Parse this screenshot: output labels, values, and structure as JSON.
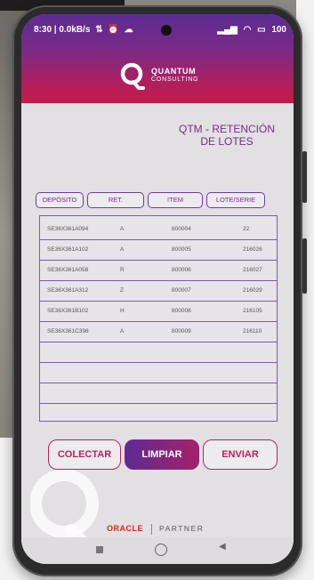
{
  "status_bar": {
    "left_text": "8:30 | 0.0kB/s",
    "right_text": "100"
  },
  "brand": {
    "line1": "QUANTUM",
    "line2": "CONSULTING"
  },
  "page": {
    "title_line1": "QTM - RETENCIÓN",
    "title_line2": "DE LOTES"
  },
  "columns": [
    "DEPÓSITO",
    "RET.",
    "ITEM",
    "LOTE/SERIE"
  ],
  "rows": [
    {
      "deposito": "SE36X361A094",
      "ret": "A",
      "item": "800004",
      "lote": "22"
    },
    {
      "deposito": "SE36X361A102",
      "ret": "A",
      "item": "800005",
      "lote": "216026"
    },
    {
      "deposito": "SE36X361A058",
      "ret": "R",
      "item": "800006",
      "lote": "216027"
    },
    {
      "deposito": "SE36X361A312",
      "ret": "Z",
      "item": "800007",
      "lote": "216029"
    },
    {
      "deposito": "SE36X361B102",
      "ret": "H",
      "item": "800008",
      "lote": "216105"
    },
    {
      "deposito": "SE36X361C398",
      "ret": "A",
      "item": "800009",
      "lote": "216110"
    }
  ],
  "buttons": {
    "collect": "COLECTAR",
    "clear": "LIMPIAR",
    "send": "ENVIAR"
  },
  "footer": {
    "oracle": "ORACLE",
    "partner": "PARTNER"
  },
  "icons": {
    "data_icon": "transfer-icon",
    "alarm": "alarm-icon",
    "cloud": "cloud-icon",
    "signal": "signal-icon",
    "wifi": "wifi-icon",
    "battery": "battery-icon"
  },
  "colors": {
    "primary_purple": "#5b2c92",
    "accent_magenta": "#b8225e",
    "oracle_red": "#d0261b"
  }
}
